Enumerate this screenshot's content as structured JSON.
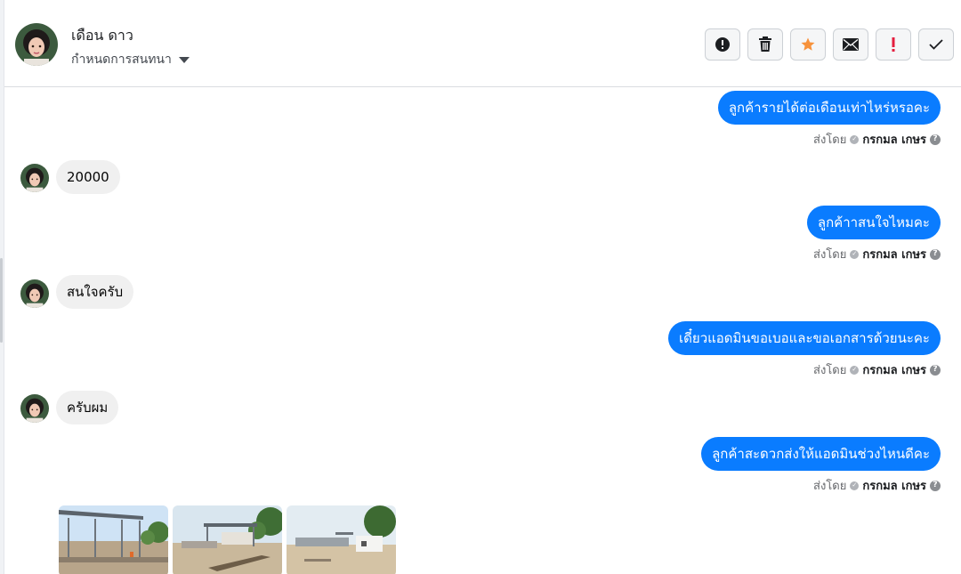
{
  "contact": {
    "name": "เดือน ดาว",
    "label_dropdown": "กำหนดการสนทนา"
  },
  "actions": [
    {
      "name": "report-spam-button",
      "icon": "exclamation-circle-icon"
    },
    {
      "name": "delete-button",
      "icon": "trash-icon"
    },
    {
      "name": "star-button",
      "icon": "star-icon"
    },
    {
      "name": "mark-unread-button",
      "icon": "envelope-icon"
    },
    {
      "name": "mark-important-button",
      "icon": "exclamation-icon"
    },
    {
      "name": "mark-done-button",
      "icon": "check-icon"
    }
  ],
  "messages": {
    "m1": {
      "direction": "out",
      "text": "ลูกค้ารายได้ต่อเดือนเท่าไหร่หรอคะ",
      "sent_by_label": "ส่งโดย",
      "agent": "กรกมล เกษร"
    },
    "m2": {
      "direction": "in",
      "text": "20000"
    },
    "m3": {
      "direction": "out",
      "text": "ลูกค้าาสนใจไหมคะ",
      "sent_by_label": "ส่งโดย",
      "agent": "กรกมล เกษร"
    },
    "m4": {
      "direction": "in",
      "text": "สนใจครับ"
    },
    "m5": {
      "direction": "out",
      "text": "เดี๋ยวแอดมินขอเบอและขอเอกสารด้วยนะคะ",
      "sent_by_label": "ส่งโดย",
      "agent": "กรกมล เกษร"
    },
    "m6": {
      "direction": "in",
      "text": "ครับผม"
    },
    "m7": {
      "direction": "out",
      "text": "ลูกค้าสะดวกส่งให้แอดมินช่วงไหนดีคะ",
      "sent_by_label": "ส่งโดย",
      "agent": "กรกมล เกษร"
    }
  },
  "attachments": {
    "photo_count": 3
  },
  "colors": {
    "outgoing_bubble": "#0a7cff",
    "incoming_bubble": "#f0f0f0",
    "star": "#f7923b",
    "important": "#e41e3f"
  }
}
